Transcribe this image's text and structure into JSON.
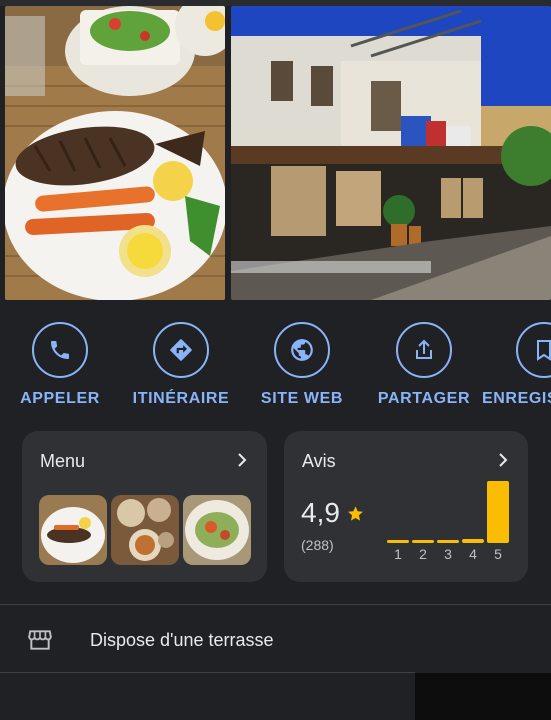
{
  "photos": [
    {
      "name": "food-photo",
      "alt": "Grilled fish plate"
    },
    {
      "name": "street-photo",
      "alt": "Restaurant facade"
    }
  ],
  "actions": [
    {
      "id": "call",
      "label": "APPELER",
      "icon": "phone-icon"
    },
    {
      "id": "directions",
      "label": "ITINÉRAIRE",
      "icon": "directions-icon"
    },
    {
      "id": "website",
      "label": "SITE WEB",
      "icon": "globe-icon"
    },
    {
      "id": "share",
      "label": "PARTAGER",
      "icon": "share-icon"
    },
    {
      "id": "save",
      "label": "ENREGIS",
      "icon": "bookmark-icon"
    }
  ],
  "menu_card": {
    "title": "Menu",
    "thumbnails": 3
  },
  "reviews_card": {
    "title": "Avis",
    "rating": "4,9",
    "count": "(288)",
    "distribution": [
      {
        "star": "1",
        "fraction": 0.03
      },
      {
        "star": "2",
        "fraction": 0.03
      },
      {
        "star": "3",
        "fraction": 0.03
      },
      {
        "star": "4",
        "fraction": 0.06
      },
      {
        "star": "5",
        "fraction": 1.0
      }
    ]
  },
  "features": [
    {
      "icon": "storefront-icon",
      "text": "Dispose d'une terrasse"
    }
  ],
  "colors": {
    "accent": "#8ab4f8",
    "star": "#fbbc04",
    "card": "#303134",
    "background": "#202124"
  }
}
